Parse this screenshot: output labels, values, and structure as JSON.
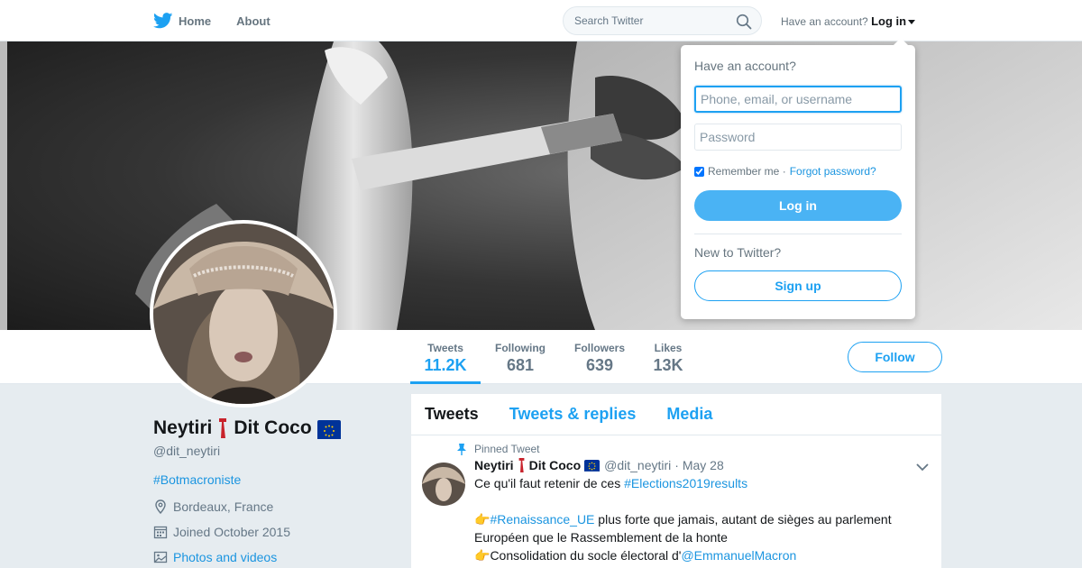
{
  "nav": {
    "home_label": "Home",
    "about_label": "About",
    "search_placeholder": "Search Twitter",
    "account_prompt": "Have an account?",
    "login_label": "Log in"
  },
  "profile": {
    "name_first": "Neytiri",
    "name_second": "Dit Coco",
    "handle": "@dit_neytiri",
    "bio": "#Botmacroniste",
    "location": "Bordeaux, France",
    "joined": "Joined October 2015",
    "photos_link": "Photos and videos"
  },
  "stats": [
    {
      "label": "Tweets",
      "value": "11.2K"
    },
    {
      "label": "Following",
      "value": "681"
    },
    {
      "label": "Followers",
      "value": "639"
    },
    {
      "label": "Likes",
      "value": "13K"
    }
  ],
  "follow_label": "Follow",
  "timeline": {
    "tabs": [
      "Tweets",
      "Tweets & replies",
      "Media"
    ],
    "pinned_label": "Pinned Tweet",
    "tweet": {
      "name_first": "Neytiri",
      "name_second": "Dit Coco",
      "handle": "@dit_neytiri",
      "date": "· May 28",
      "line1_text": "Ce qu'il faut retenir de ces ",
      "line1_link": "#Elections2019results",
      "line2_emoji": "👉",
      "line2_link": "#Renaissance_UE",
      "line2_text": " plus forte que jamais, autant de sièges au parlement",
      "line3_text": "Européen que le Rassemblement de la honte",
      "line4_emoji": "👉",
      "line4_text": "Consolidation du socle électoral d'",
      "line4_link": "@EmmanuelMacron"
    }
  },
  "login_dropdown": {
    "title": "Have an account?",
    "username_placeholder": "Phone, email, or username",
    "password_placeholder": "Password",
    "remember_label": "Remember me ·",
    "forgot_label": "Forgot password?",
    "login_button": "Log in",
    "new_prompt": "New to Twitter?",
    "signup_button": "Sign up"
  },
  "colors": {
    "brand": "#1da1f2",
    "link": "#1b95e0",
    "login_button": "#4ab3f4",
    "background": "#e6ecf0"
  }
}
